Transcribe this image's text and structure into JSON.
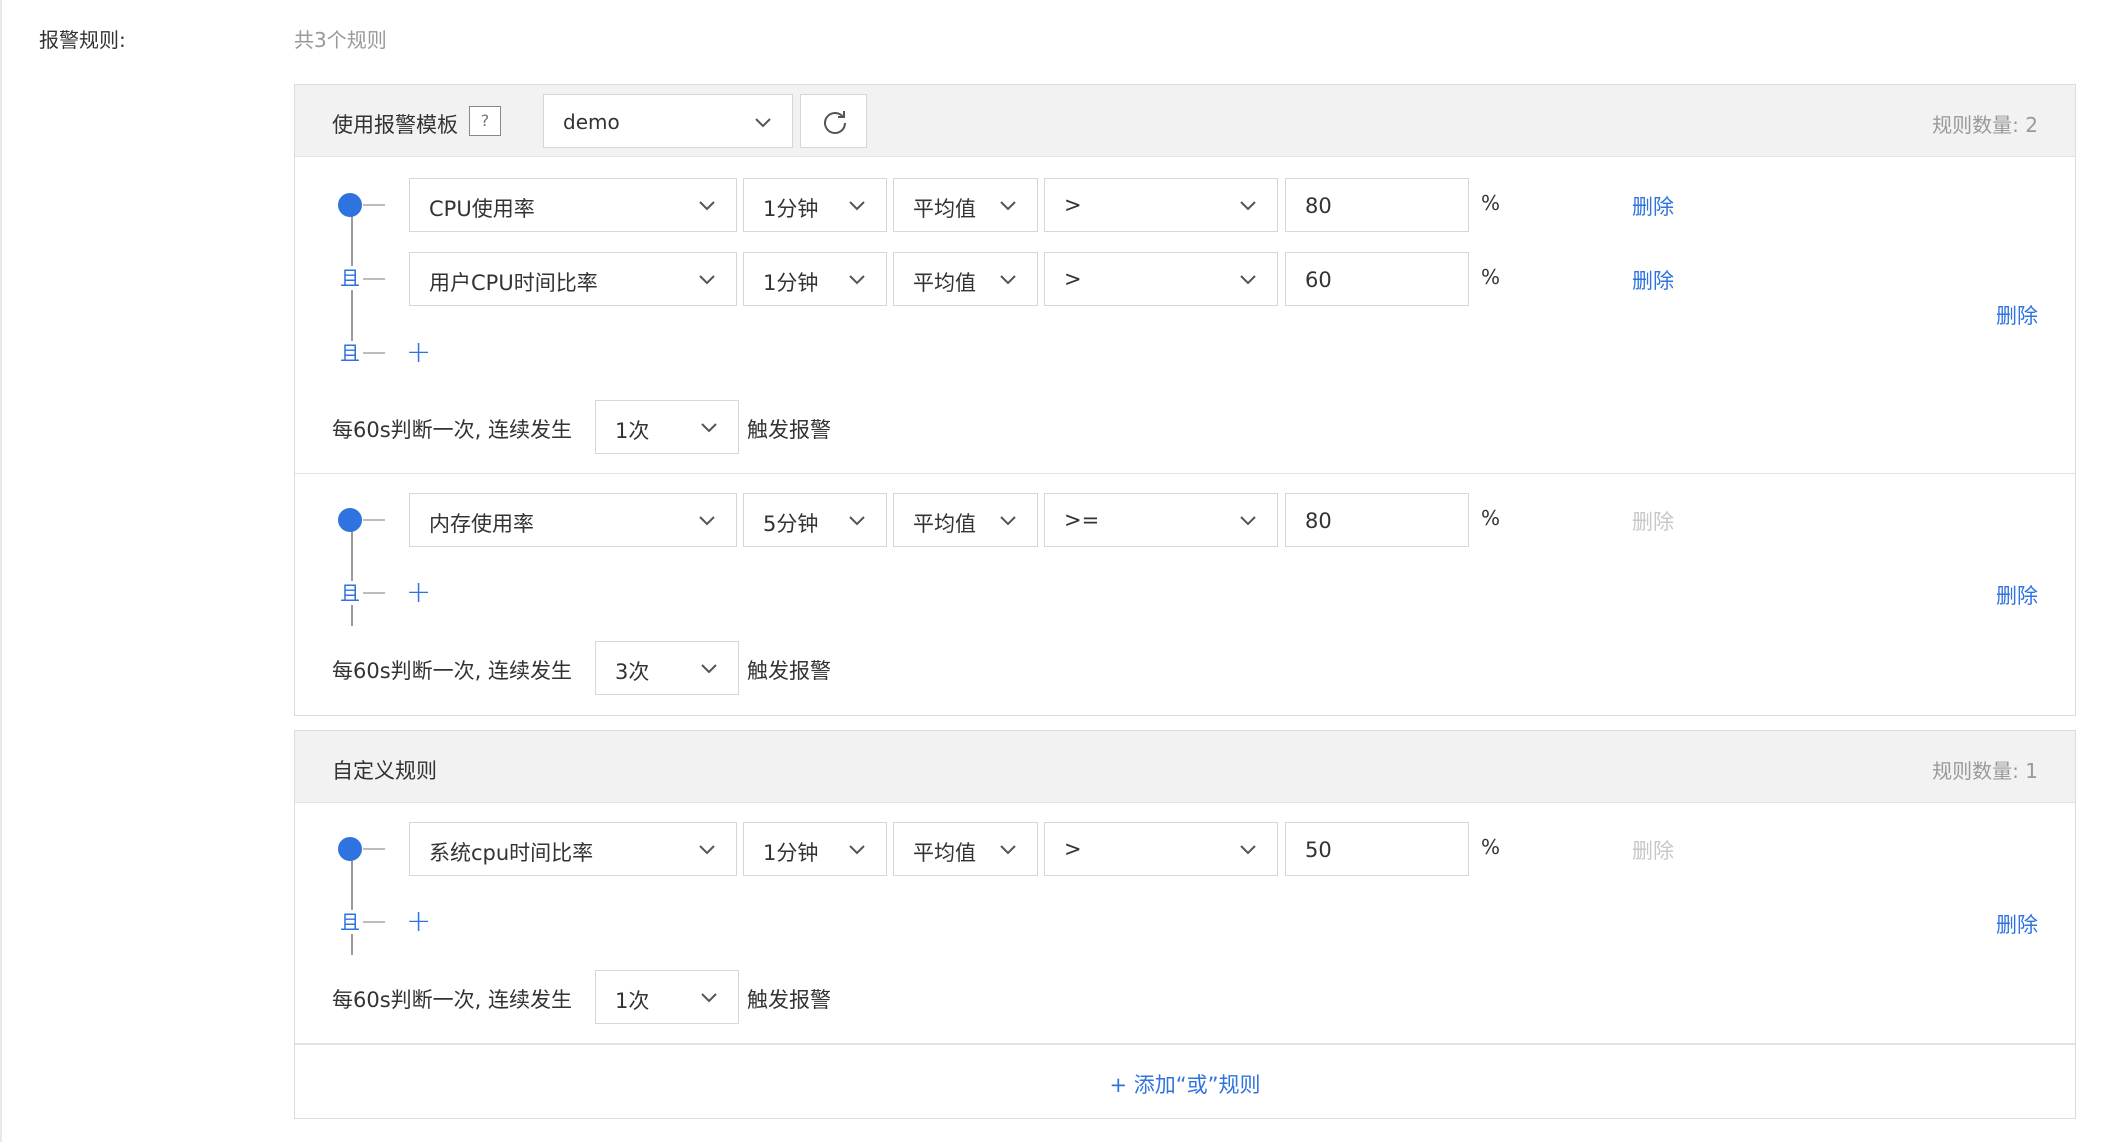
{
  "field_label": "报警规则:",
  "summary": "共3个规则",
  "template_panel": {
    "title": "使用报警模板",
    "help_icon": "?",
    "template_value": "demo",
    "rule_count": "规则数量: 2",
    "groups": [
      {
        "conditions": [
          {
            "metric": "CPU使用率",
            "period": "1分钟",
            "stat": "平均值",
            "op": ">",
            "threshold": "80",
            "unit": "%",
            "delete": "删除"
          },
          {
            "metric": "用户CPU时间比率",
            "period": "1分钟",
            "stat": "平均值",
            "op": ">",
            "threshold": "60",
            "unit": "%",
            "delete": "删除"
          }
        ],
        "and_label": "且",
        "delete_group": "删除",
        "trigger_pre": "每60s判断一次, 连续发生",
        "times": "1次",
        "trigger_post": "触发报警"
      },
      {
        "conditions": [
          {
            "metric": "内存使用率",
            "period": "5分钟",
            "stat": "平均值",
            "op": ">=",
            "threshold": "80",
            "unit": "%",
            "delete": "删除"
          }
        ],
        "and_label": "且",
        "delete_group": "删除",
        "trigger_pre": "每60s判断一次, 连续发生",
        "times": "3次",
        "trigger_post": "触发报警"
      }
    ]
  },
  "custom_panel": {
    "title": "自定义规则",
    "rule_count": "规则数量: 1",
    "groups": [
      {
        "conditions": [
          {
            "metric": "系统cpu时间比率",
            "period": "1分钟",
            "stat": "平均值",
            "op": ">",
            "threshold": "50",
            "unit": "%",
            "delete": "删除"
          }
        ],
        "and_label": "且",
        "delete_group": "删除",
        "trigger_pre": "每60s判断一次, 连续发生",
        "times": "1次",
        "trigger_post": "触发报警"
      }
    ],
    "add_or_rule": "+ 添加“或”规则"
  },
  "colors": {
    "accent": "#2f73e0",
    "disabled": "#c8c8c8",
    "header_bg": "#f2f2f2"
  }
}
